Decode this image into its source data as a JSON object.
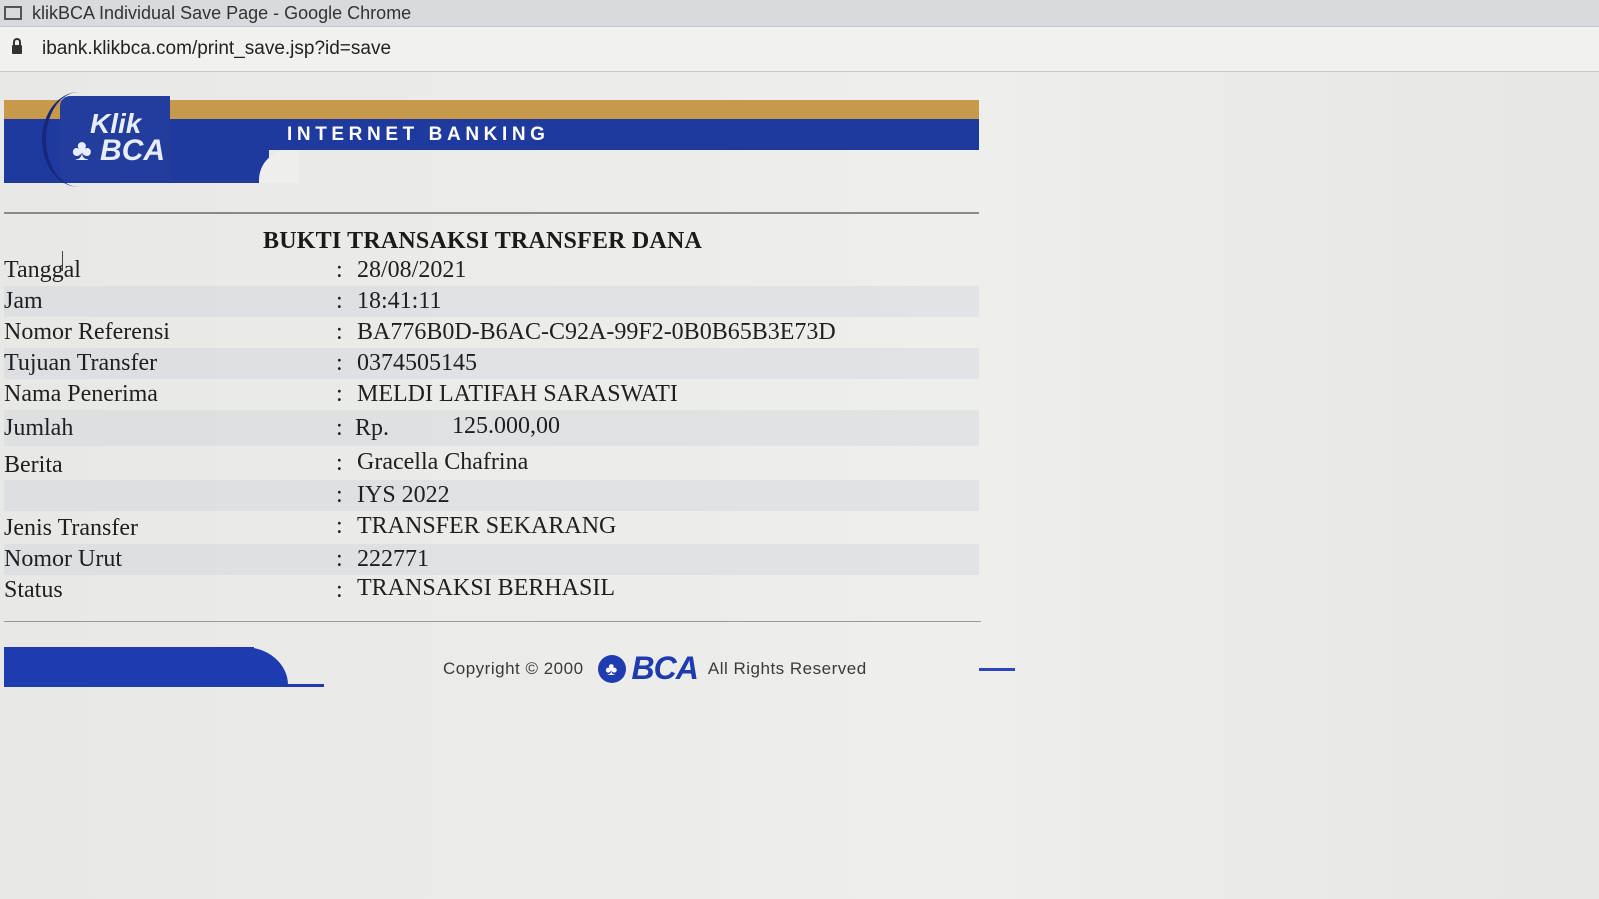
{
  "window": {
    "title": "klikBCA Individual Save Page - Google Chrome",
    "url": "ibank.klikbca.com/print_save.jsp?id=save"
  },
  "banner": {
    "logo_line1": "Klik",
    "logo_line2": "♣ BCA",
    "title": "INTERNET BANKING"
  },
  "receipt": {
    "title": "BUKTI TRANSAKSI TRANSFER DANA",
    "rows": [
      {
        "label": "Tanggal",
        "value": "28/08/2021"
      },
      {
        "label": "Jam",
        "value": "18:41:11"
      },
      {
        "label": "Nomor Referensi",
        "value": "BA776B0D-B6AC-C92A-99F2-0B0B65B3E73D"
      },
      {
        "label": "Tujuan Transfer",
        "value": "0374505145"
      },
      {
        "label": "Nama Penerima",
        "value": "MELDI LATIFAH SARASWATI"
      },
      {
        "label": "Jumlah",
        "currency": "Rp.",
        "value": "125.000,00"
      },
      {
        "label": "Berita",
        "value": "Gracella Chafrina"
      },
      {
        "label": "",
        "value": "IYS 2022"
      },
      {
        "label": "Jenis Transfer",
        "value": "TRANSFER SEKARANG"
      },
      {
        "label": "Nomor Urut",
        "value": "222771"
      },
      {
        "label": "Status",
        "value": "TRANSAKSI BERHASIL"
      }
    ],
    "separator": ":"
  },
  "footer": {
    "copyright": "Copyright © 2000",
    "brand": "BCA",
    "rights": "All Rights Reserved"
  },
  "colors": {
    "brand_blue": "#1f3a9e",
    "banner_orange": "#c69a4a"
  }
}
